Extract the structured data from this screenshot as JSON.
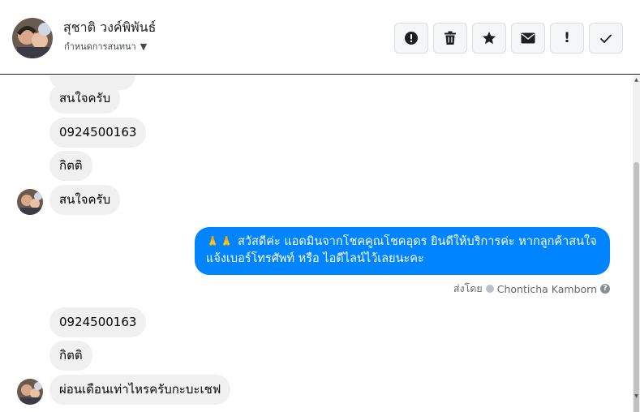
{
  "header": {
    "contact_name": "สุชาติ วงค์พิพันธ์",
    "subtitle": "กำหนดการสนทนา",
    "caret": "▼"
  },
  "toolbar": {
    "buttons": [
      {
        "name": "alert-circle",
        "icon": "alert-circle-icon"
      },
      {
        "name": "delete",
        "icon": "trash-icon"
      },
      {
        "name": "star",
        "icon": "star-icon"
      },
      {
        "name": "mark-unread",
        "icon": "envelope-icon"
      },
      {
        "name": "important",
        "icon": "exclamation-icon",
        "glyph": "!"
      },
      {
        "name": "done",
        "icon": "checkmark-icon"
      }
    ]
  },
  "messages": {
    "m1": "สนใจครับ",
    "m2": "0924500163",
    "m3": "กิตติ",
    "m4": "สนใจครับ",
    "outgoing_emoji": "🙏🙏",
    "outgoing_line1": "สวัสดีค่ะ แอดมินจากโชคคูณโชคอุดร ยินดีให้บริการค่ะ หากลูกค้าสนใจ",
    "outgoing_line2": "แจ้งเบอร์โทรศัพท์ หรือ ไอดีไลน์ไว้เลยนะคะ",
    "sent_by_label": "ส่งโดย",
    "sent_by_name": "Chonticha Kamborn",
    "help_glyph": "?",
    "m5": "0924500163",
    "m6": "กิตติ",
    "m7": "ผ่อนเดือนเท่าไหรครับกะบะเชฟ"
  },
  "colors": {
    "outgoing_bubble": "#0084ff",
    "incoming_bubble": "#f0f0f0",
    "toolbar_button_bg": "#f5f6f7"
  }
}
